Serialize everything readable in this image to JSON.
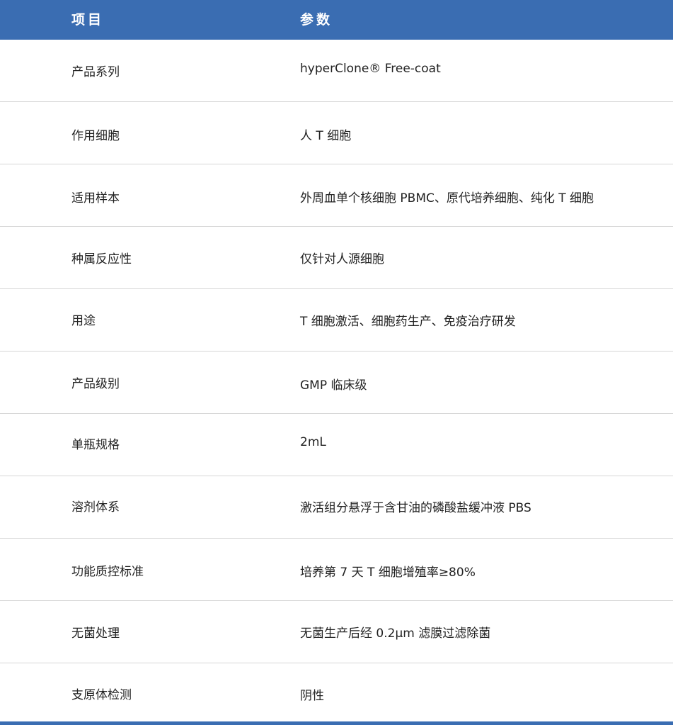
{
  "table": {
    "header": {
      "item": "项目",
      "param": "参数"
    },
    "rows": [
      {
        "item": "产品系列",
        "value": "hyperClone® Free-coat"
      },
      {
        "item": "作用细胞",
        "value": "人 T 细胞"
      },
      {
        "item": "适用样本",
        "value": "外周血单个核细胞 PBMC、原代培养细胞、纯化 T 细胞"
      },
      {
        "item": "种属反应性",
        "value": "仅针对人源细胞"
      },
      {
        "item": "用途",
        "value": "T 细胞激活、细胞药生产、免疫治疗研发"
      },
      {
        "item": "产品级别",
        "value": "GMP 临床级"
      },
      {
        "item": "单瓶规格",
        "value": "2mL"
      },
      {
        "item": "溶剂体系",
        "value": "激活组分悬浮于含甘油的磷酸盐缓冲液 PBS"
      },
      {
        "item": "功能质控标准",
        "value": "培养第 7 天 T 细胞增殖率≥80%"
      },
      {
        "item": "无菌处理",
        "value": "无菌生产后经 0.2μm 滤膜过滤除菌"
      },
      {
        "item": "支原体检测",
        "value": "阴性"
      }
    ]
  },
  "colors": {
    "header_bg": "#3a6db2",
    "header_text": "#ffffff",
    "row_text": "#222222",
    "divider": "#d6d6d6"
  }
}
